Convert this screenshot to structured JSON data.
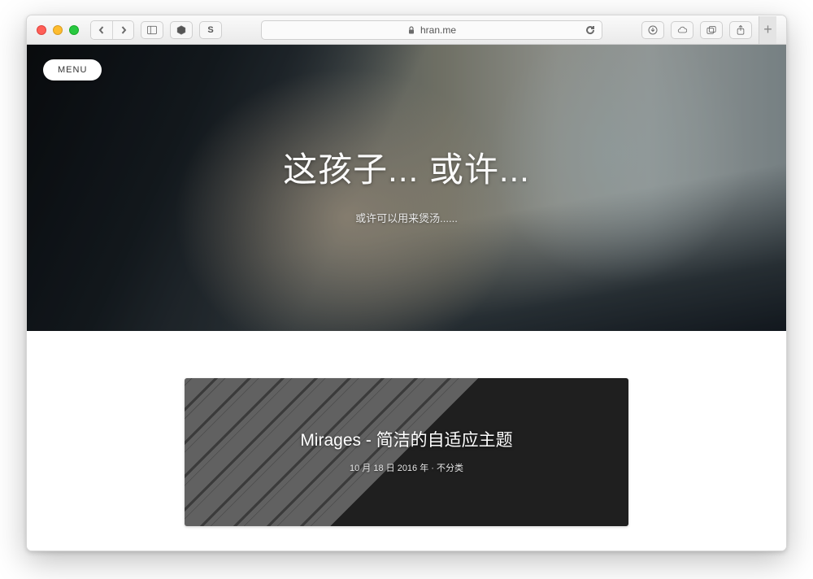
{
  "browser": {
    "url_host": "hran.me",
    "sidebar_btn_label": "S"
  },
  "page": {
    "menu_button": "MENU",
    "hero_title": "这孩子... 或许...",
    "hero_subtitle": "或许可以用来煲汤......",
    "card": {
      "title": "Mirages - 简洁的自适应主题",
      "meta": "10 月 18 日 2016 年 · 不分类"
    }
  }
}
